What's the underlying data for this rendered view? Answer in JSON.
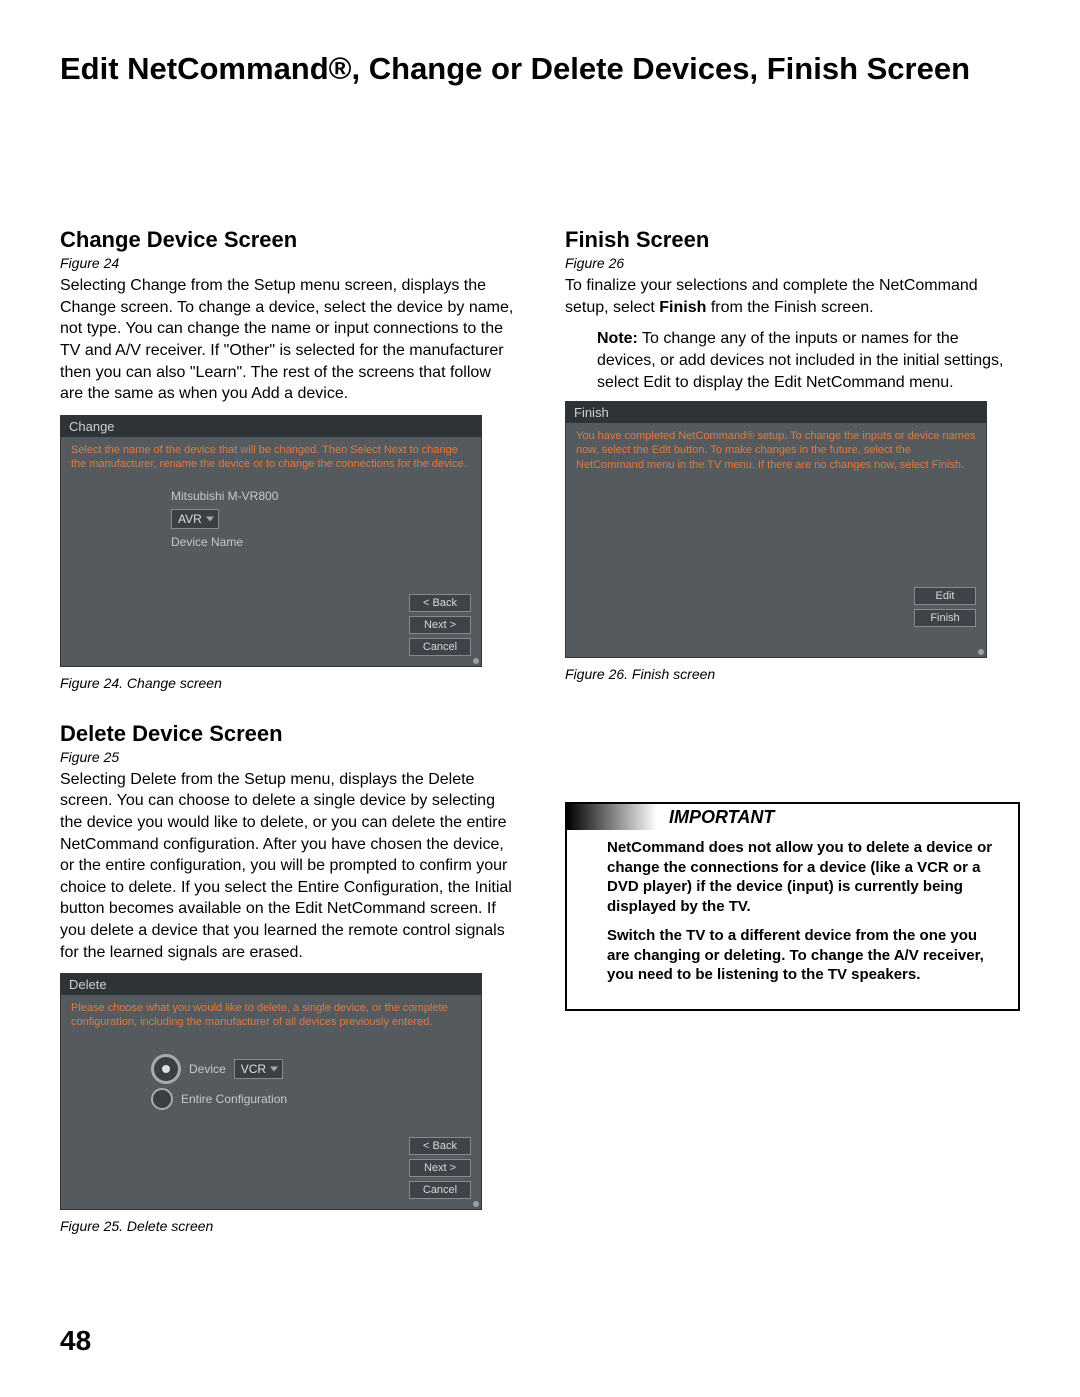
{
  "page_title": "Edit NetCommand®, Change or Delete Devices, Finish Screen",
  "page_number": "48",
  "left": {
    "change": {
      "heading": "Change Device Screen",
      "fig_ref": "Figure 24",
      "body": "Selecting Change from the Setup menu screen, displays the Change screen. To change a device, select the device by name, not type.  You can change the name or input connections to the TV and A/V receiver.  If \"Other\" is selected for the manufacturer then you can also \"Learn\".  The rest of the screens that follow are the same as when you Add a device.",
      "shot": {
        "title": "Change",
        "instr": "Select the name of the device that will be changed.  Then Select Next to change the manufacturer, rename the device or to change the connections for the device.",
        "row1": "Mitsubishi M-VR800",
        "dropdown": "AVR",
        "row2": "Device Name",
        "buttons": {
          "back": "< Back",
          "next": "Next >",
          "cancel": "Cancel"
        }
      },
      "caption": "Figure 24. Change screen"
    },
    "delete": {
      "heading": "Delete Device Screen",
      "fig_ref": "Figure 25",
      "body": "Selecting Delete from the Setup menu, displays the Delete screen.  You can choose to delete a single device by selecting the device you would like to delete, or you can delete the entire NetCommand configuration.  After you have chosen the device, or the entire configuration, you will be prompted to confirm your choice to delete.  If you select the Entire Configuration, the Initial button becomes available on the Edit NetCommand screen.  If you delete a device that you learned the remote control signals for the learned signals are erased.",
      "shot": {
        "title": "Delete",
        "instr": "Please choose what you would like to delete, a single device, or the complete configuration, including the manufacturer of all devices previously entered.",
        "opt1_label": "Device",
        "opt1_value": "VCR",
        "opt2_label": "Entire Configuration",
        "buttons": {
          "back": "< Back",
          "next": "Next >",
          "cancel": "Cancel"
        }
      },
      "caption": "Figure 25. Delete screen"
    }
  },
  "right": {
    "finish": {
      "heading": "Finish Screen",
      "fig_ref": "Figure 26",
      "body_pre": "To finalize your selections and complete the NetCommand setup, select ",
      "body_bold": "Finish",
      "body_post": " from the Finish screen.",
      "note_label": "Note:",
      "note_body": "  To change any of the inputs or names for the devices, or add devices not included in the initial settings, select Edit to display the Edit NetCommand menu.",
      "shot": {
        "title": "Finish",
        "instr": "You have completed NetCommand® setup.  To change the inputs or device names now, select the Edit button.  To make changes in the future, select the NetCommand menu in the TV menu.  If there are no changes now, select Finish.",
        "buttons": {
          "edit": "Edit",
          "finish": "Finish"
        }
      },
      "caption": "Figure 26. Finish screen"
    },
    "important": {
      "title": "IMPORTANT",
      "p1": "NetCommand does not allow you to delete a device or change the connections for a device (like a VCR or a DVD player) if the device (input) is currently being displayed by the TV.",
      "p2": "Switch the TV to a different device from the one you are changing or deleting.  To change the A/V receiver, you need to be listening to the TV speakers."
    }
  }
}
